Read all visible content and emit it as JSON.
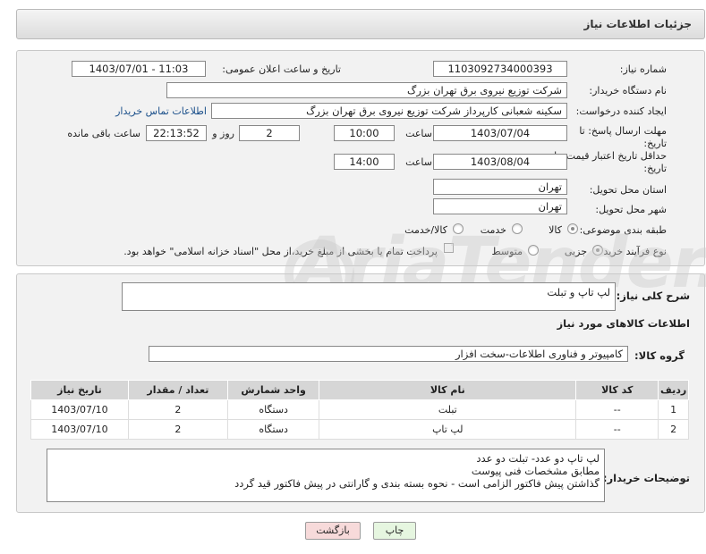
{
  "header": {
    "title": "جزئیات اطلاعات نیاز"
  },
  "fields": {
    "need_number_label": "شماره نیاز:",
    "need_number": "1103092734000393",
    "announce_label": "تاریخ و ساعت اعلان عمومی:",
    "announce_value": "1403/07/01 - 11:03",
    "buyer_label": "نام دستگاه خریدار:",
    "buyer_value": "شرکت توزیع نیروی برق تهران بزرگ",
    "creator_label": "ایجاد کننده درخواست:",
    "creator_value": "سکینه شعبانی کارپرداز شرکت توزیع نیروی برق تهران بزرگ",
    "contact_link": "اطلاعات تماس خریدار",
    "deadline_label_1": "مهلت ارسال پاسخ: تا",
    "deadline_label_2": "تاریخ:",
    "deadline_date": "1403/07/04",
    "time_label": "ساعت",
    "deadline_time": "10:00",
    "days_value": "2",
    "days_label": "روز و",
    "remaining_time": "22:13:52",
    "remaining_label": "ساعت باقی مانده",
    "validity_label_1": "حداقل تاریخ اعتبار قیمت: تا",
    "validity_label_2": "تاریخ:",
    "validity_date": "1403/08/04",
    "validity_time": "14:00",
    "province_label": "استان محل تحویل:",
    "province_value": "تهران",
    "city_label": "شهر محل تحویل:",
    "city_value": "تهران",
    "category_label": "طبقه بندی موضوعی:",
    "category_options": [
      "کالا",
      "خدمت",
      "کالا/خدمت"
    ],
    "category_selected": "کالا",
    "purchase_label": "نوع فرآیند خرید :",
    "purchase_options": [
      "جزیی",
      "متوسط"
    ],
    "purchase_selected": "جزیی",
    "payment_note": "پرداخت تمام یا بخشی از مبلغ خرید،از محل \"اسناد خزانه اسلامی\" خواهد بود."
  },
  "general": {
    "description_label": "شرح کلی نیاز:",
    "description_value": "لپ تاپ و تبلت",
    "goods_info_title": "اطلاعات کالاهای مورد نیاز",
    "goods_group_label": "گروه کالا:",
    "goods_group_value": "کامپیوتر و فناوری اطلاعات-سخت افزار"
  },
  "table": {
    "headers": [
      "ردیف",
      "کد کالا",
      "نام کالا",
      "واحد شمارش",
      "تعداد / مقدار",
      "تاریخ نیاز"
    ],
    "rows": [
      [
        "1",
        "--",
        "تبلت",
        "دستگاه",
        "2",
        "1403/07/10"
      ],
      [
        "2",
        "--",
        "لپ تاپ",
        "دستگاه",
        "2",
        "1403/07/10"
      ]
    ]
  },
  "buyer_notes": {
    "label": "توضیحات خریدار:",
    "lines": [
      "لپ تاپ دو عدد- تبلت دو عدد",
      "مطابق مشخصات فنی پیوست",
      "گذاشتن پیش فاکتور الزامی است - نحوه بسته بندی و گارانتی در پیش فاکتور قید گردد"
    ]
  },
  "buttons": {
    "print": "چاپ",
    "back": "بازگشت"
  },
  "watermark": {
    "text": "AriaTender.neT"
  },
  "colors": {
    "link": "#1a4f8a",
    "back_button_bg": "#f7dada",
    "print_button_bg": "#e6f6e0"
  }
}
